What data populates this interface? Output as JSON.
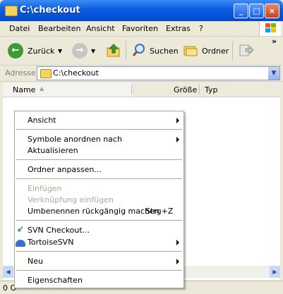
{
  "window": {
    "title": "C:\\checkout"
  },
  "menubar": {
    "items": [
      "Datei",
      "Bearbeiten",
      "Ansicht",
      "Favoriten",
      "Extras",
      "?"
    ]
  },
  "toolbar": {
    "back_label": "Zurück",
    "search_label": "Suchen",
    "folders_label": "Ordner"
  },
  "address": {
    "label": "Adresse",
    "value": "C:\\checkout"
  },
  "columns": {
    "name": "Name",
    "size": "Größe",
    "type": "Typ"
  },
  "statusbar": {
    "text": "0 O"
  },
  "context_menu": {
    "view": "Ansicht",
    "arrange_icons": "Symbole anordnen nach",
    "refresh": "Aktualisieren",
    "customize_folder": "Ordner anpassen...",
    "paste": "Einfügen",
    "paste_shortcut": "Verknüpfung einfügen",
    "undo_rename": "Umbenennen rückgängig machen",
    "undo_rename_shortcut": "Strg+Z",
    "svn_checkout": "SVN Checkout...",
    "tortoise_svn": "TortoiseSVN",
    "new": "Neu",
    "properties": "Eigenschaften"
  },
  "colors": {
    "titlebar": "#0a5ce0",
    "menu_disabled": "#aca899",
    "back_button": "#3b9b35"
  }
}
